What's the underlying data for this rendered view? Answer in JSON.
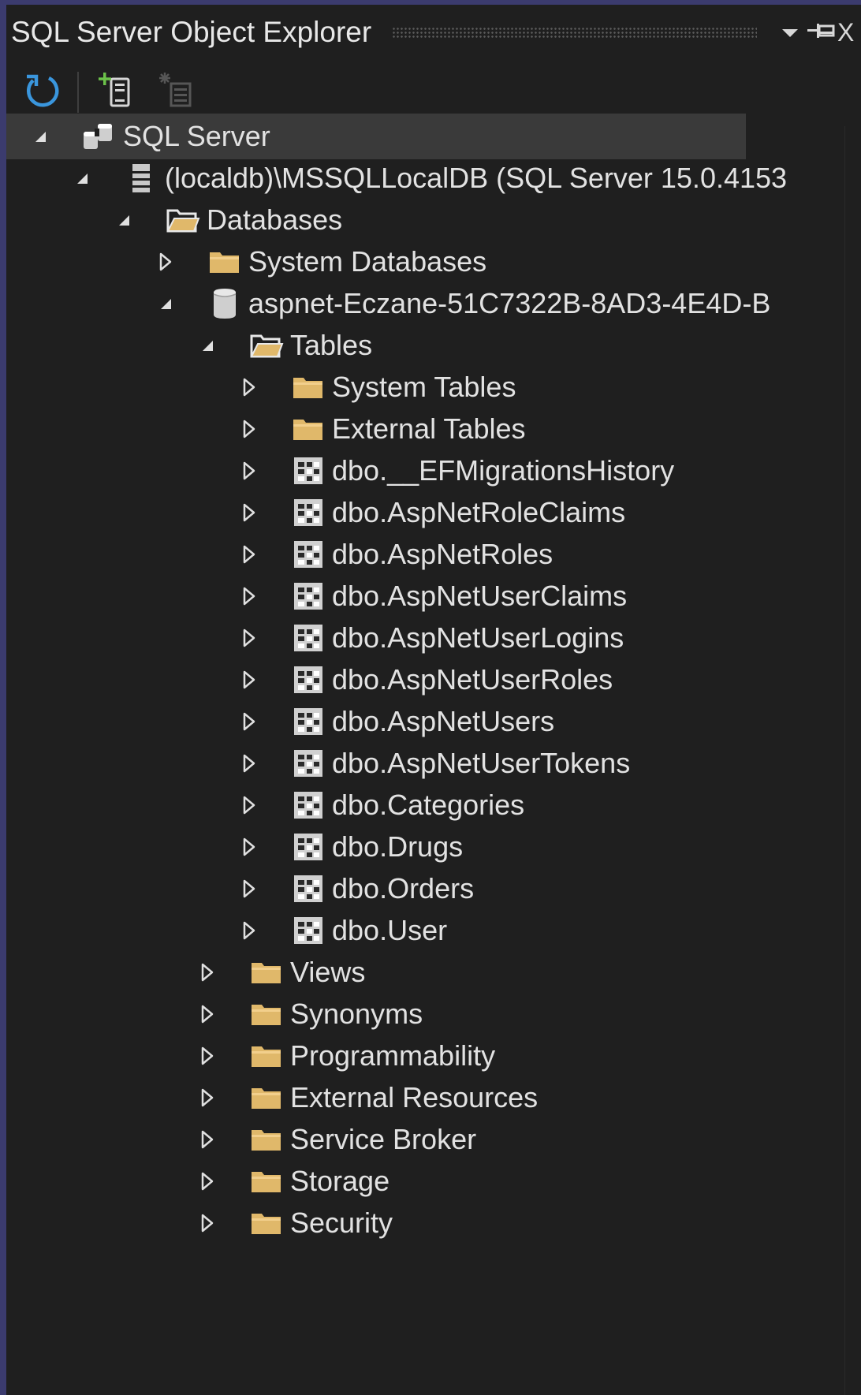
{
  "window": {
    "title": "SQL Server Object Explorer",
    "controls": [
      "dropdown-icon",
      "pin-icon",
      "close-icon"
    ],
    "close_glyph": "X"
  },
  "toolbar": {
    "buttons": [
      {
        "name": "refresh-button",
        "icon": "refresh-icon",
        "enabled": true
      },
      {
        "name": "add-sql-server-button",
        "icon": "add-server-icon",
        "enabled": true
      },
      {
        "name": "new-query-button",
        "icon": "new-query-icon",
        "enabled": false
      }
    ]
  },
  "colors": {
    "background": "#1f1f1f",
    "selected_row": "#3a3a3a",
    "text": "#e2e2e2",
    "folder": "#e0b86a",
    "refresh_blue": "#3a96dd",
    "add_green": "#6cc24a"
  },
  "tree": {
    "nodes": [
      {
        "label": "SQL Server",
        "icon": "sql-server-icon",
        "expanded": true,
        "level": 0,
        "selected": true
      },
      {
        "label": "(localdb)\\MSSQLLocalDB (SQL Server 15.0.4153",
        "icon": "server-instance-icon",
        "expanded": true,
        "level": 1
      },
      {
        "label": "Databases",
        "icon": "open-folder-icon",
        "expanded": true,
        "level": 2
      },
      {
        "label": "System Databases",
        "icon": "folder-icon",
        "expanded": false,
        "level": 3
      },
      {
        "label": "aspnet-Eczane-51C7322B-8AD3-4E4D-B",
        "icon": "database-icon",
        "expanded": true,
        "level": 3
      },
      {
        "label": "Tables",
        "icon": "open-folder-icon",
        "expanded": true,
        "level": 4
      },
      {
        "label": "System Tables",
        "icon": "folder-icon",
        "expanded": false,
        "level": 5
      },
      {
        "label": "External Tables",
        "icon": "folder-icon",
        "expanded": false,
        "level": 5
      },
      {
        "label": "dbo.__EFMigrationsHistory",
        "icon": "table-icon",
        "expanded": false,
        "level": 5
      },
      {
        "label": "dbo.AspNetRoleClaims",
        "icon": "table-icon",
        "expanded": false,
        "level": 5
      },
      {
        "label": "dbo.AspNetRoles",
        "icon": "table-icon",
        "expanded": false,
        "level": 5
      },
      {
        "label": "dbo.AspNetUserClaims",
        "icon": "table-icon",
        "expanded": false,
        "level": 5
      },
      {
        "label": "dbo.AspNetUserLogins",
        "icon": "table-icon",
        "expanded": false,
        "level": 5
      },
      {
        "label": "dbo.AspNetUserRoles",
        "icon": "table-icon",
        "expanded": false,
        "level": 5
      },
      {
        "label": "dbo.AspNetUsers",
        "icon": "table-icon",
        "expanded": false,
        "level": 5
      },
      {
        "label": "dbo.AspNetUserTokens",
        "icon": "table-icon",
        "expanded": false,
        "level": 5
      },
      {
        "label": "dbo.Categories",
        "icon": "table-icon",
        "expanded": false,
        "level": 5
      },
      {
        "label": "dbo.Drugs",
        "icon": "table-icon",
        "expanded": false,
        "level": 5
      },
      {
        "label": "dbo.Orders",
        "icon": "table-icon",
        "expanded": false,
        "level": 5
      },
      {
        "label": "dbo.User",
        "icon": "table-icon",
        "expanded": false,
        "level": 5
      },
      {
        "label": "Views",
        "icon": "folder-icon",
        "expanded": false,
        "level": 4
      },
      {
        "label": "Synonyms",
        "icon": "folder-icon",
        "expanded": false,
        "level": 4
      },
      {
        "label": "Programmability",
        "icon": "folder-icon",
        "expanded": false,
        "level": 4
      },
      {
        "label": "External Resources",
        "icon": "folder-icon",
        "expanded": false,
        "level": 4
      },
      {
        "label": "Service Broker",
        "icon": "folder-icon",
        "expanded": false,
        "level": 4
      },
      {
        "label": "Storage",
        "icon": "folder-icon",
        "expanded": false,
        "level": 4
      },
      {
        "label": "Security",
        "icon": "folder-icon",
        "expanded": false,
        "level": 4
      }
    ]
  }
}
